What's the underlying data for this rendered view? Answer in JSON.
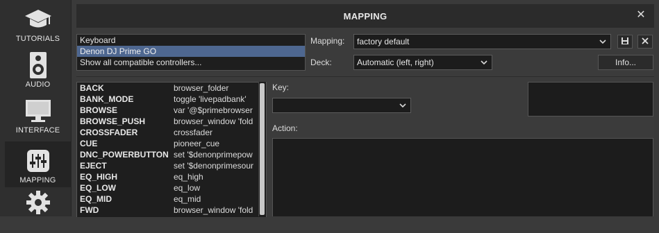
{
  "sidebar": {
    "items": [
      {
        "label": "TUTORIALS",
        "icon": "graduation-cap-icon"
      },
      {
        "label": "AUDIO",
        "icon": "speaker-icon"
      },
      {
        "label": "INTERFACE",
        "icon": "monitor-icon"
      },
      {
        "label": "MAPPING",
        "icon": "sliders-icon",
        "active": true
      },
      {
        "label": "",
        "icon": "gear-icon"
      }
    ]
  },
  "dialog": {
    "title": "MAPPING",
    "close_glyph": "✕"
  },
  "controllers": [
    "Keyboard",
    "Denon DJ Prime GO",
    "Show all compatible controllers..."
  ],
  "selected_controller": 1,
  "mapping": {
    "label": "Mapping:",
    "value": "factory default"
  },
  "deck": {
    "label": "Deck:",
    "value": "Automatic (left, right)"
  },
  "info_button": "Info...",
  "key": {
    "label": "Key:",
    "value": ""
  },
  "action": {
    "label": "Action:"
  },
  "key_list": [
    {
      "name": "BACK",
      "action": "browser_folder"
    },
    {
      "name": "BANK_MODE",
      "action": "toggle 'livepadbank'"
    },
    {
      "name": "BROWSE",
      "action": "var '@$primebrowser"
    },
    {
      "name": "BROWSE_PUSH",
      "action": "browser_window 'fold"
    },
    {
      "name": "CROSSFADER",
      "action": "crossfader"
    },
    {
      "name": "CUE",
      "action": "pioneer_cue"
    },
    {
      "name": "DNC_POWERBUTTON",
      "action": "set '$denonprimepow"
    },
    {
      "name": "EJECT",
      "action": "set '$denonprimesour"
    },
    {
      "name": "EQ_HIGH",
      "action": "eq_high"
    },
    {
      "name": "EQ_LOW",
      "action": "eq_low"
    },
    {
      "name": "EQ_MID",
      "action": "eq_mid"
    },
    {
      "name": "FWD",
      "action": "browser_window 'fold"
    }
  ],
  "colors": {
    "selection": "#4e6790",
    "panel": "#3b3b3b",
    "titlebar": "#2b2b2b"
  }
}
